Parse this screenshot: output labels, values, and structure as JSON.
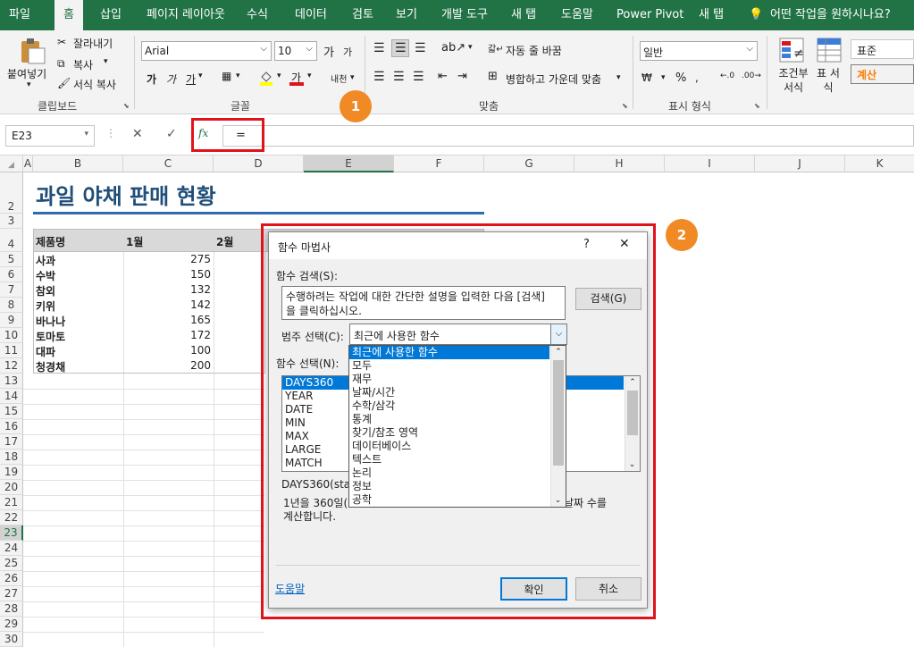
{
  "ribbon_tabs": [
    "파일",
    "홈",
    "삽입",
    "페이지 레이아웃",
    "수식",
    "데이터",
    "검토",
    "보기",
    "개발 도구",
    "새 탭",
    "도움말",
    "Power Pivot",
    "새 탭"
  ],
  "tell_me": "어떤 작업을 원하시나요?",
  "clipboard": {
    "paste": "붙여넣기",
    "cut": "잘라내기",
    "copy": "복사",
    "format_painter": "서식 복사",
    "label": "클립보드"
  },
  "font": {
    "name": "Arial",
    "size": "10",
    "bold": "가",
    "italic": "가",
    "underline": "가",
    "grow": "가",
    "shrink": "가",
    "phonetic": "내천",
    "label": "글꼴"
  },
  "alignment": {
    "wrap": "자동 줄 바꿈",
    "merge": "병합하고 가운데 맞춤",
    "label": "맞춤"
  },
  "number": {
    "format": "일반",
    "percent": "%",
    "label": "표시 형식"
  },
  "styles": {
    "conditional": "조건부 서식",
    "table": "표 서식",
    "normal": "표준",
    "calc": "계산"
  },
  "formula_bar": {
    "name_box": "E23",
    "cancel": "✕",
    "enter": "✓",
    "fx": "fx",
    "content": "="
  },
  "columns": [
    "A",
    "B",
    "C",
    "D",
    "E",
    "F",
    "G",
    "H",
    "I",
    "J",
    "K"
  ],
  "rows": [
    "2",
    "3",
    "4",
    "5",
    "6",
    "7",
    "8",
    "9",
    "10",
    "11",
    "12",
    "13",
    "14",
    "15",
    "16",
    "17",
    "18",
    "19",
    "20",
    "21",
    "22",
    "23",
    "24",
    "25",
    "26",
    "27",
    "28",
    "29",
    "30"
  ],
  "sheet": {
    "title": "과일 야채 판매 현황",
    "headers": [
      "제품명",
      "1월",
      "2월"
    ],
    "data": [
      {
        "name": "사과",
        "jan": "275"
      },
      {
        "name": "수박",
        "jan": "150"
      },
      {
        "name": "참외",
        "jan": "132"
      },
      {
        "name": "키위",
        "jan": "142"
      },
      {
        "name": "바나나",
        "jan": "165"
      },
      {
        "name": "토마토",
        "jan": "172"
      },
      {
        "name": "대파",
        "jan": "100"
      },
      {
        "name": "청경채",
        "jan": "200"
      }
    ]
  },
  "dialog": {
    "title": "함수 마법사",
    "help_q": "?",
    "close": "✕",
    "search_label": "함수 검색(S):",
    "search_text_1": "수행하려는 작업에 대한 간단한 설명을 입력한 다음 [검색]",
    "search_text_2": "을 클릭하십시오.",
    "search_button": "검색(G)",
    "category_label": "범주 선택(C):",
    "category_value": "최근에 사용한 함수",
    "categories": [
      "최근에 사용한 함수",
      "모두",
      "재무",
      "날짜/시간",
      "수학/삼각",
      "통계",
      "찾기/참조 영역",
      "데이터베이스",
      "텍스트",
      "논리",
      "정보",
      "공학"
    ],
    "function_label": "함수 선택(N):",
    "functions": [
      "DAYS360",
      "YEAR",
      "DATE",
      "MIN",
      "MAX",
      "LARGE",
      "MATCH"
    ],
    "syntax": "DAYS360(star",
    "desc_1a": "1년을 360일(",
    "desc_1b": "날짜 수를",
    "desc_2": "계산합니다.",
    "help_link": "도움말",
    "ok": "확인",
    "cancel": "취소"
  },
  "badges": [
    "1",
    "2"
  ]
}
